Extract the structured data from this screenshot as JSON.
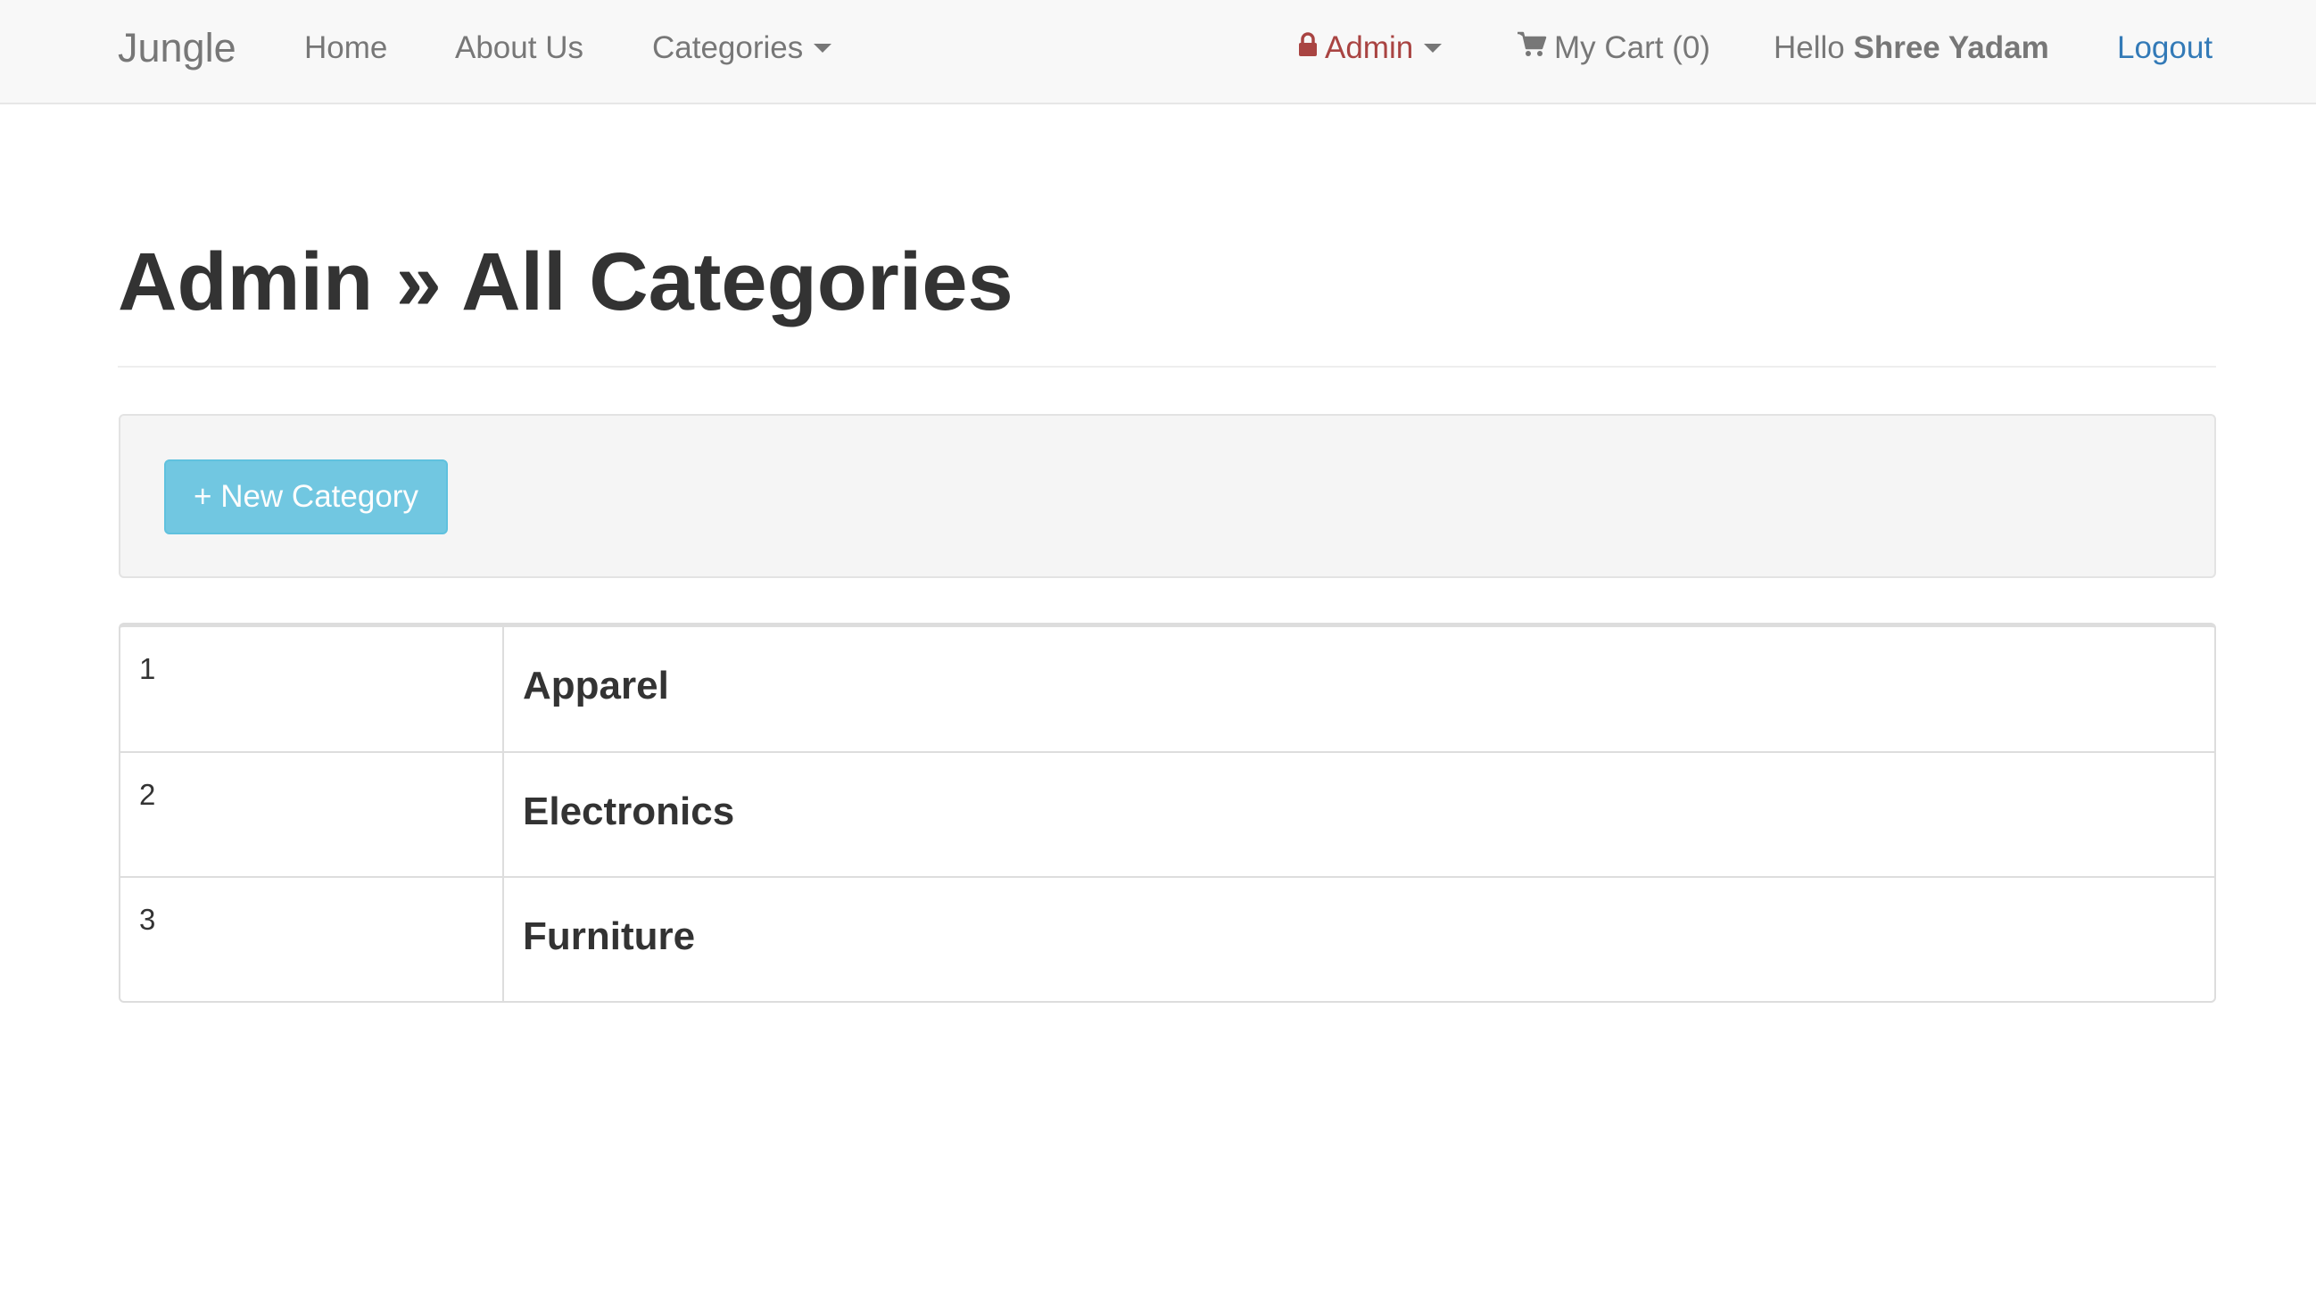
{
  "navbar": {
    "brand": "Jungle",
    "home": "Home",
    "about": "About Us",
    "categories": "Categories",
    "admin": "Admin",
    "cart": "My Cart (0)",
    "hello_prefix": "Hello",
    "hello_name": "Shree Yadam",
    "logout": "Logout"
  },
  "icons": {
    "admin": "lock-icon",
    "cart": "shopping-cart-icon",
    "dropdown": "caret-down-icon"
  },
  "colors": {
    "admin_link": "#a94442",
    "logout_link": "#337ab7",
    "info_button": "#5bc0de"
  },
  "page": {
    "title": "Admin » All Categories"
  },
  "toolbar": {
    "new_category_label": "+ New Category"
  },
  "categories": [
    {
      "id": "1",
      "name": "Apparel"
    },
    {
      "id": "2",
      "name": "Electronics"
    },
    {
      "id": "3",
      "name": "Furniture"
    }
  ]
}
